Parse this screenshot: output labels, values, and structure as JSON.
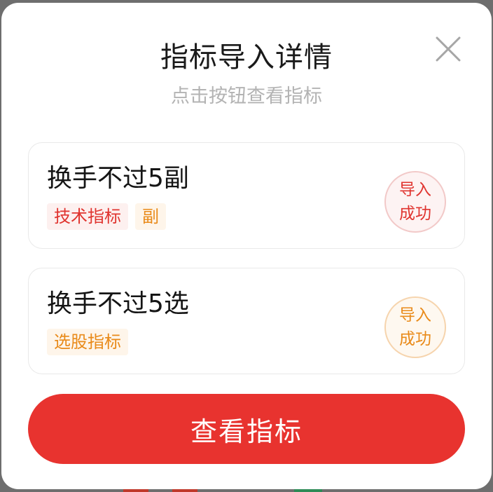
{
  "modal": {
    "title": "指标导入详情",
    "subtitle": "点击按钮查看指标",
    "close_icon": "close-icon"
  },
  "indicators": [
    {
      "name": "换手不过5副",
      "tags": [
        "技术指标",
        "副"
      ],
      "tag_colors": [
        "#e0342f",
        "#e98a19"
      ],
      "status_line1": "导入",
      "status_line2": "成功",
      "status_color": "#e0342f"
    },
    {
      "name": "换手不过5选",
      "tags": [
        "选股指标"
      ],
      "tag_colors": [
        "#e98a19"
      ],
      "status_line1": "导入",
      "status_line2": "成功",
      "status_color": "#e98a19"
    }
  ],
  "action_button": {
    "label": "查看指标",
    "color": "#e8332f"
  }
}
